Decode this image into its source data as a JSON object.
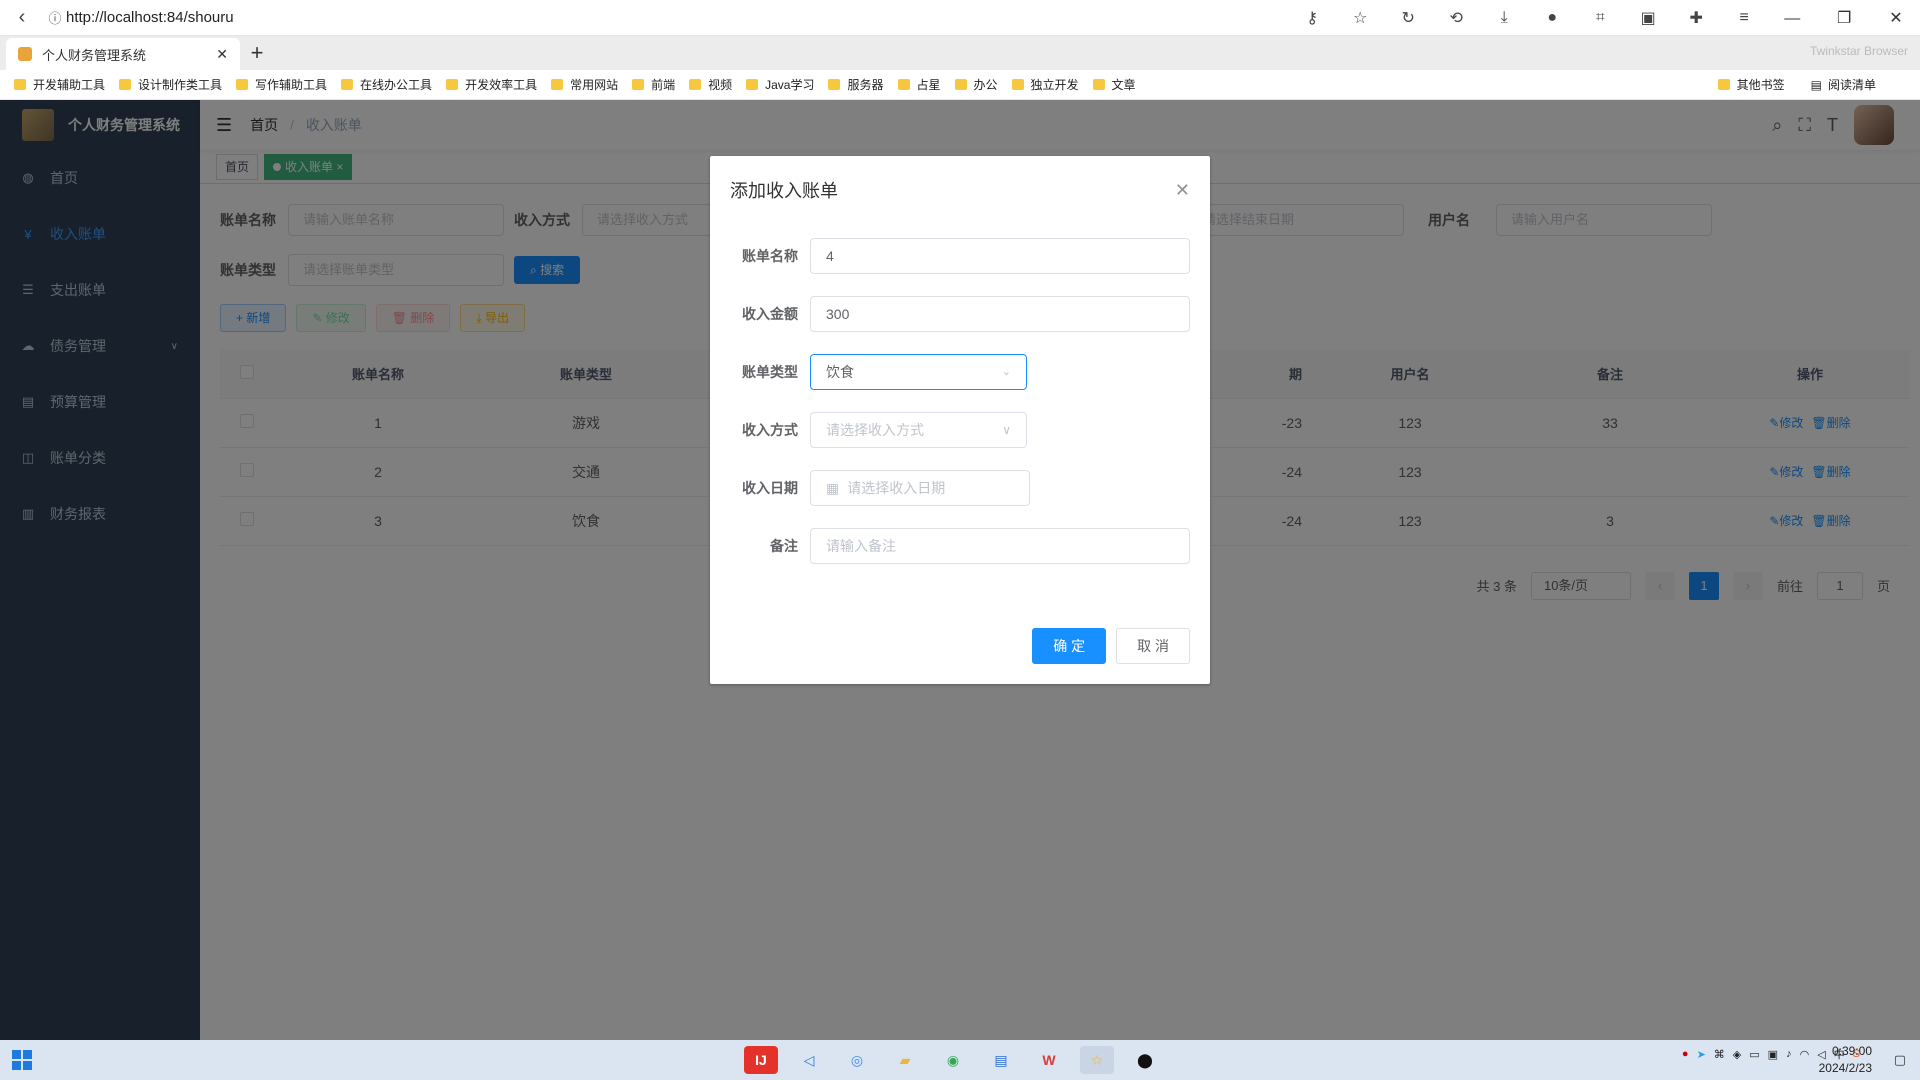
{
  "browser": {
    "url": "http://localhost:84/shouru",
    "tab_title": "个人财务管理系统",
    "brand": "Twinkstar Browser",
    "bookmarks": [
      "开发辅助工具",
      "设计制作类工具",
      "写作辅助工具",
      "在线办公工具",
      "开发效率工具",
      "常用网站",
      "前端",
      "视频",
      "Java学习",
      "服务器",
      "占星",
      "办公",
      "独立开发",
      "文章"
    ],
    "bookmarks_right": [
      "其他书签",
      "阅读清单"
    ]
  },
  "app": {
    "title": "个人财务管理系统",
    "menu": [
      {
        "label": "首页",
        "icon": "dashboard-icon"
      },
      {
        "label": "收入账单",
        "icon": "yen-icon"
      },
      {
        "label": "支出账单",
        "icon": "list-icon"
      },
      {
        "label": "债务管理",
        "icon": "cloud-icon"
      },
      {
        "label": "预算管理",
        "icon": "document-icon"
      },
      {
        "label": "账单分类",
        "icon": "book-icon"
      },
      {
        "label": "财务报表",
        "icon": "bar-chart-icon"
      }
    ],
    "breadcrumb": {
      "home": "首页",
      "current": "收入账单"
    },
    "tags": {
      "home": "首页",
      "current": "收入账单"
    }
  },
  "search": {
    "name_label": "账单名称",
    "name_placeholder": "请输入账单名称",
    "method_label": "收入方式",
    "method_placeholder": "请选择收入方式",
    "end_date_placeholder": "请选择结束日期",
    "username_label": "用户名",
    "username_placeholder": "请输入用户名",
    "type_label": "账单类型",
    "type_placeholder": "请选择账单类型",
    "search_btn": "搜索"
  },
  "toolbar": {
    "add": "新增",
    "edit": "修改",
    "delete": "删除",
    "export": "导出"
  },
  "table": {
    "headers": [
      "账单名称",
      "账单类型",
      "期",
      "用户名",
      "备注",
      "操作"
    ],
    "rows": [
      {
        "name": "1",
        "type": "游戏",
        "date": "-23",
        "user": "123",
        "note": "33"
      },
      {
        "name": "2",
        "type": "交通",
        "date": "-24",
        "user": "123",
        "note": ""
      },
      {
        "name": "3",
        "type": "饮食",
        "date": "-24",
        "user": "123",
        "note": "3"
      }
    ],
    "edit_label": "修改",
    "delete_label": "删除"
  },
  "pagination": {
    "total": "共 3 条",
    "page_size": "10条/页",
    "current_page": "1",
    "goto_label": "前往",
    "goto_value": "1",
    "page_suffix": "页"
  },
  "dialog": {
    "title": "添加收入账单",
    "fields": {
      "name": {
        "label": "账单名称",
        "value": "4"
      },
      "amount": {
        "label": "收入金额",
        "value": "300"
      },
      "type": {
        "label": "账单类型",
        "value": "饮食"
      },
      "method": {
        "label": "收入方式",
        "placeholder": "请选择收入方式"
      },
      "date": {
        "label": "收入日期",
        "placeholder": "请选择收入日期"
      },
      "note": {
        "label": "备注",
        "placeholder": "请输入备注"
      }
    },
    "confirm": "确 定",
    "cancel": "取 消"
  },
  "taskbar": {
    "time": "0:39:00",
    "date": "2024/2/23"
  }
}
